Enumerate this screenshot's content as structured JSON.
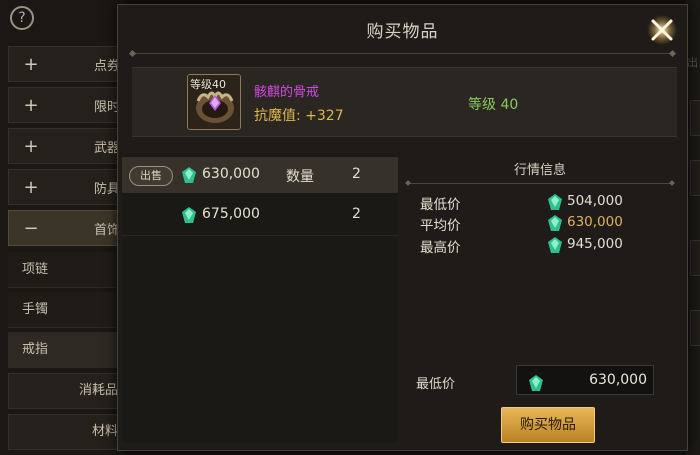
{
  "sidebar": {
    "categories_top": [
      {
        "sign": "+",
        "label": "点券"
      },
      {
        "sign": "+",
        "label": "限时"
      },
      {
        "sign": "+",
        "label": "武器"
      },
      {
        "sign": "+",
        "label": "防具"
      },
      {
        "sign": "−",
        "label": "首饰"
      }
    ],
    "subcategories": [
      "项链",
      "手镯",
      "戒指"
    ],
    "categories_bottom": [
      "消耗品",
      "材料"
    ]
  },
  "background_right_text": "出",
  "modal": {
    "title": "购买物品",
    "item": {
      "level_tag": "等级40",
      "name": "骸麒的骨戒",
      "stat_label": "抗魔值:",
      "stat_value": "+327",
      "grade": "等级 40"
    },
    "listings": [
      {
        "badge": "出售",
        "price": "630,000",
        "qty_label": "数量",
        "qty": "2"
      },
      {
        "badge": "",
        "price": "675,000",
        "qty_label": "",
        "qty": "2"
      }
    ],
    "market": {
      "title": "行情信息",
      "rows": [
        {
          "label": "最低价",
          "value": "504,000"
        },
        {
          "label": "平均价",
          "value": "630,000"
        },
        {
          "label": "最高价",
          "value": "945,000"
        }
      ]
    },
    "min_price_label": "最低价",
    "min_price_value": "630,000",
    "buy_button": "购买物品"
  },
  "colors": {
    "item_name": "#d14ae0",
    "stat": "#e0b84a",
    "grade": "#8ec95a",
    "gem": "#3fd1a0",
    "button": "#e9b756"
  }
}
